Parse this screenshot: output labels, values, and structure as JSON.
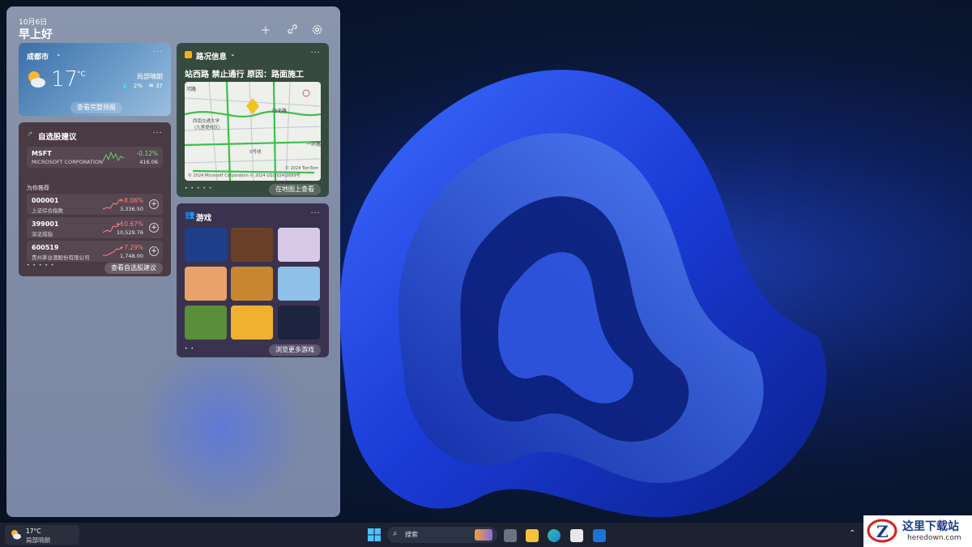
{
  "header": {
    "date": "10月6日",
    "greeting": "早上好",
    "add_icon": "plus-icon",
    "link_icon": "link-icon",
    "settings_icon": "gear-icon"
  },
  "weather": {
    "city": "成都市",
    "temp": "17",
    "unit": "°C",
    "condition": "局部晴朗",
    "humidity": "2%",
    "wind": "37",
    "more_label": "···",
    "forecast_button": "查看完整预报"
  },
  "stocks": {
    "title": "自选股建议",
    "more_label": "···",
    "watch": {
      "code": "MSFT",
      "name": "MICROSOFT CORPORATION",
      "change": "-0.12%",
      "price": "416.06"
    },
    "recommend_label": "为你推荐",
    "items": [
      {
        "code": "000001",
        "name": "上证综合指数",
        "change": "+8.06%",
        "price": "3,336.50"
      },
      {
        "code": "399001",
        "name": "深证成指",
        "change": "+10.67%",
        "price": "10,529.76"
      },
      {
        "code": "600519",
        "name": "贵州茅台酒股份有限公司",
        "change": "+7.29%",
        "price": "1,748.00"
      }
    ],
    "dots": "• • • • •",
    "button": "查看自选股建议"
  },
  "traffic": {
    "title": "路况信息",
    "headline": "站西路 禁止通行 原因：路面施工",
    "more_label": "···",
    "map_labels": [
      "河路",
      "站北路",
      "西南交通大学",
      "(九里堤校区)",
      "一环路",
      "5号线",
      "© 2024 TomTom",
      "© 2024 Microsoft Corporation © 2024 GS(2024)2689号"
    ],
    "dots": "• • • • •",
    "button": "在地图上查看"
  },
  "games": {
    "title": "游戏",
    "more_label": "···",
    "dots": "• •",
    "button": "浏览更多游戏",
    "tiles": [
      "#1f3f8a",
      "#6b4028",
      "#d9c9e8",
      "#e9a36a",
      "#c7862f",
      "#8fc1e8",
      "#5a8f3a",
      "#f0b030",
      "#1d2440"
    ]
  },
  "taskbar": {
    "temp": "17°C",
    "condition": "局部晴朗",
    "search_placeholder": "搜索",
    "chevron": "⌃"
  },
  "watermark": {
    "brand": "这里下载站",
    "url": "heredown.com"
  },
  "colors": {
    "accent": "#2a5cff",
    "positive": "#ff8080",
    "negative": "#7be07b"
  }
}
